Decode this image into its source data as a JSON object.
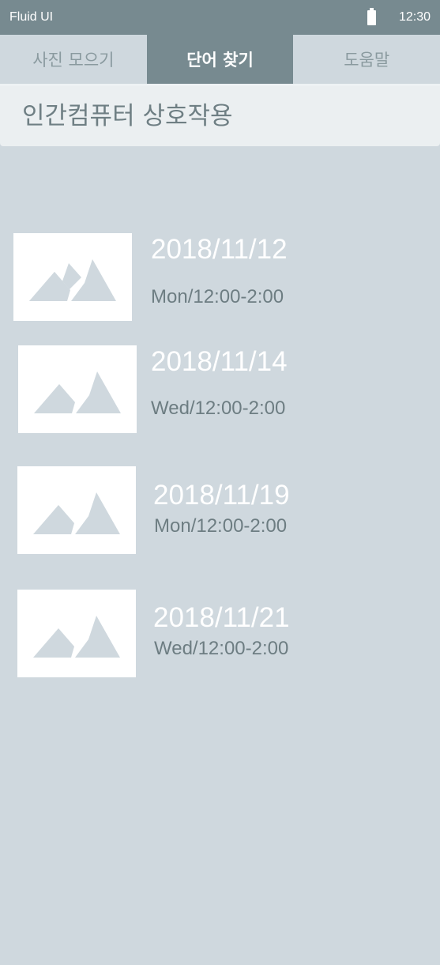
{
  "status_bar": {
    "app_name": "Fluid UI",
    "time": "12:30",
    "battery_icon": "battery-full-icon"
  },
  "tabs": [
    {
      "label": "사진 모으기",
      "active": false
    },
    {
      "label": "단어 찾기",
      "active": true
    },
    {
      "label": "도움말",
      "active": false
    }
  ],
  "header": {
    "title": "인간컴퓨터 상호작용"
  },
  "list": {
    "items": [
      {
        "date": "2018/11/12",
        "time": "Mon/12:00-2:00",
        "thumbnail_icon": "image-placeholder-icon"
      },
      {
        "date": "2018/11/14",
        "time": "Wed/12:00-2:00",
        "thumbnail_icon": "image-placeholder-icon"
      },
      {
        "date": "2018/11/19",
        "time": "Mon/12:00-2:00",
        "thumbnail_icon": "image-placeholder-icon"
      },
      {
        "date": "2018/11/21",
        "time": "Wed/12:00-2:00",
        "thumbnail_icon": "image-placeholder-icon"
      }
    ]
  },
  "colors": {
    "status_bar": "#778a90",
    "active_tab": "#778a90",
    "background": "#cfd8de",
    "title_bar": "#ebeff1",
    "date_text": "#ffffff",
    "time_text": "#6d7d82"
  }
}
